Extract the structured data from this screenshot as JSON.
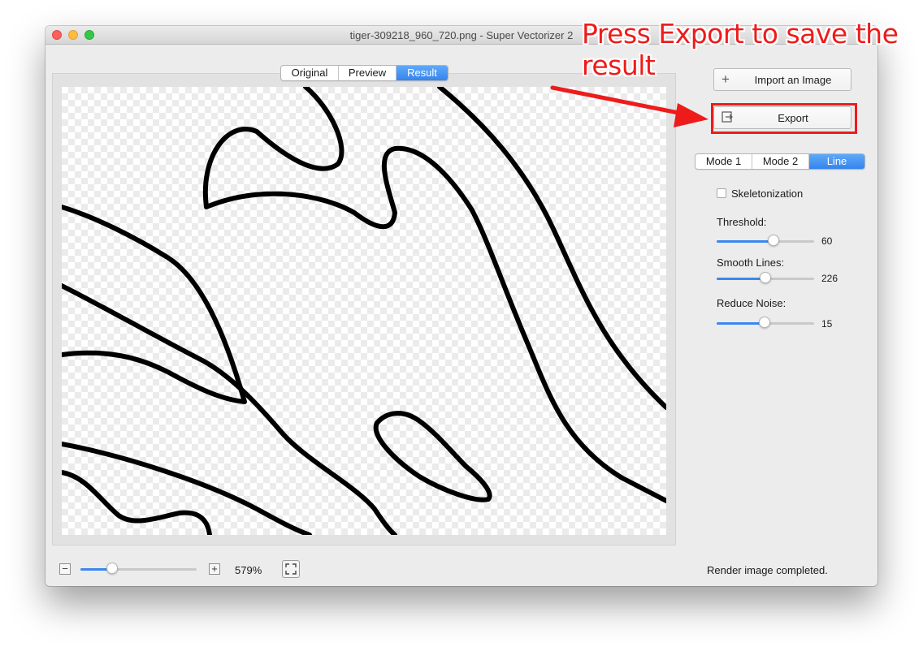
{
  "window": {
    "title": "tiger-309218_960_720.png - Super Vectorizer 2"
  },
  "view_tabs": [
    {
      "label": "Original",
      "active": false
    },
    {
      "label": "Preview",
      "active": false
    },
    {
      "label": "Result",
      "active": true
    }
  ],
  "sidebar": {
    "import_label": "Import an Image",
    "import_icon": "plus-icon",
    "export_label": "Export",
    "export_icon": "export-icon",
    "mode_tabs": [
      {
        "label": "Mode 1",
        "active": false
      },
      {
        "label": "Mode 2",
        "active": false
      },
      {
        "label": "Line",
        "active": true
      }
    ],
    "skeletonization": {
      "label": "Skeletonization",
      "checked": false
    },
    "threshold": {
      "label": "Threshold:",
      "value": "60",
      "fraction": 0.58
    },
    "smooth_lines": {
      "label": "Smooth Lines:",
      "value": "226",
      "fraction": 0.5
    },
    "reduce_noise": {
      "label": "Reduce Noise:",
      "value": "15",
      "fraction": 0.49
    }
  },
  "bottom_bar": {
    "zoom_out_icon": "minus-icon",
    "zoom_in_icon": "plus-icon",
    "zoom_level": "579%",
    "zoom_fraction": 0.27,
    "fit_icon": "fit-to-window-icon",
    "status": "Render image completed."
  },
  "annotation": {
    "text": "Press Export to save the result",
    "color": "#ee1b1b"
  },
  "colors": {
    "accent": "#3b87ee",
    "active_segment": "#3584ee",
    "window_bg": "#ececec"
  }
}
